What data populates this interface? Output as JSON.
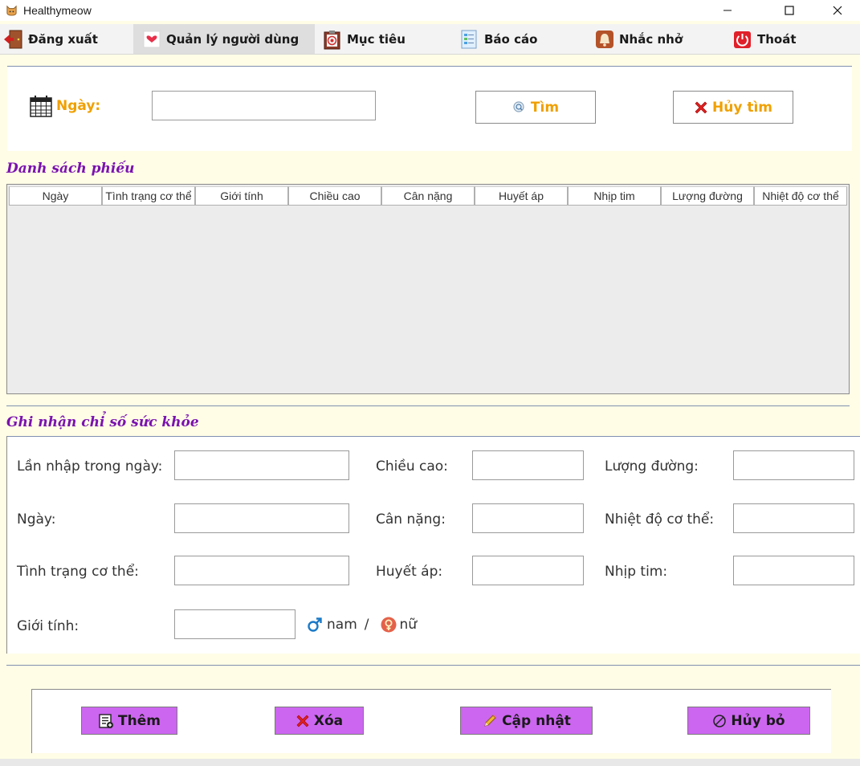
{
  "window": {
    "title": "Healthymeow",
    "app_icon": "cat-icon",
    "controls": [
      "minimize-icon",
      "maximize-icon",
      "close-icon"
    ]
  },
  "menu": {
    "items": [
      {
        "label": "Đăng xuất",
        "icon": "logout-door-icon"
      },
      {
        "label": "Quản lý người dùng",
        "icon": "heart-user-icon",
        "active": true
      },
      {
        "label": "Mục tiêu",
        "icon": "target-clipboard-icon"
      },
      {
        "label": "Báo cáo",
        "icon": "report-document-icon"
      },
      {
        "label": "Nhắc nhở",
        "icon": "bell-reminder-icon"
      },
      {
        "label": "Thoát",
        "icon": "power-exit-icon"
      }
    ]
  },
  "search": {
    "date_label": "Ngày:",
    "date_value": "",
    "search_button": "Tìm",
    "cancel_button": "Hủy tìm"
  },
  "list": {
    "title": "Danh sách phiếu",
    "columns": [
      "Ngày",
      "Tình trạng cơ thể",
      "Giới tính",
      "Chiều cao",
      "Cân nặng",
      "Huyết áp",
      "Nhịp tim",
      "Lượng đường",
      "Nhiệt độ cơ thể"
    ],
    "rows": []
  },
  "form": {
    "title": "Ghi nhận chỉ số sức khỏe",
    "fields": {
      "entry_count": {
        "label": "Lần nhập trong ngày:",
        "value": ""
      },
      "date": {
        "label": "Ngày:",
        "value": ""
      },
      "body_condition": {
        "label": "Tình trạng cơ thể:",
        "value": ""
      },
      "gender": {
        "label": "Giới tính:",
        "value": ""
      },
      "height": {
        "label": "Chiều cao:",
        "value": ""
      },
      "weight": {
        "label": "Cân nặng:",
        "value": ""
      },
      "blood_pressure": {
        "label": "Huyết áp:",
        "value": ""
      },
      "blood_sugar": {
        "label": "Lượng đường:",
        "value": ""
      },
      "body_temperature": {
        "label": "Nhiệt độ cơ thể:",
        "value": ""
      },
      "heart_rate": {
        "label": "Nhịp tim:",
        "value": ""
      }
    },
    "gender_hint": {
      "male": "nam",
      "separator": "/",
      "female": "nữ"
    }
  },
  "actions": {
    "add": "Thêm",
    "delete": "Xóa",
    "update": "Cập nhật",
    "cancel": "Hủy bỏ"
  },
  "colors": {
    "background": "#fffde6",
    "accent_orange": "#f0a000",
    "section_purple": "#7a12b0",
    "action_button": "#cc66f0"
  }
}
